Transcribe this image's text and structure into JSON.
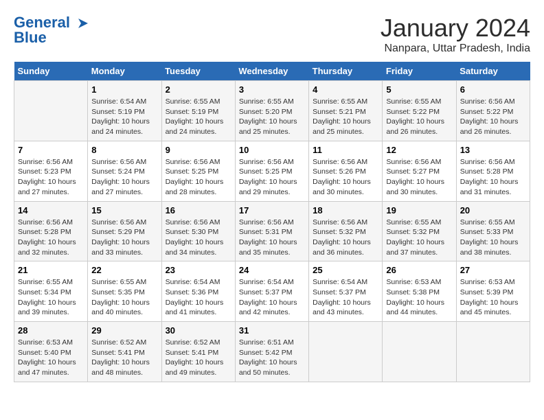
{
  "logo": {
    "line1": "General",
    "line2": "Blue"
  },
  "title": "January 2024",
  "subtitle": "Nanpara, Uttar Pradesh, India",
  "days_of_week": [
    "Sunday",
    "Monday",
    "Tuesday",
    "Wednesday",
    "Thursday",
    "Friday",
    "Saturday"
  ],
  "weeks": [
    [
      {
        "day": "",
        "sunrise": "",
        "sunset": "",
        "daylight": ""
      },
      {
        "day": "1",
        "sunrise": "Sunrise: 6:54 AM",
        "sunset": "Sunset: 5:19 PM",
        "daylight": "Daylight: 10 hours and 24 minutes."
      },
      {
        "day": "2",
        "sunrise": "Sunrise: 6:55 AM",
        "sunset": "Sunset: 5:19 PM",
        "daylight": "Daylight: 10 hours and 24 minutes."
      },
      {
        "day": "3",
        "sunrise": "Sunrise: 6:55 AM",
        "sunset": "Sunset: 5:20 PM",
        "daylight": "Daylight: 10 hours and 25 minutes."
      },
      {
        "day": "4",
        "sunrise": "Sunrise: 6:55 AM",
        "sunset": "Sunset: 5:21 PM",
        "daylight": "Daylight: 10 hours and 25 minutes."
      },
      {
        "day": "5",
        "sunrise": "Sunrise: 6:55 AM",
        "sunset": "Sunset: 5:22 PM",
        "daylight": "Daylight: 10 hours and 26 minutes."
      },
      {
        "day": "6",
        "sunrise": "Sunrise: 6:56 AM",
        "sunset": "Sunset: 5:22 PM",
        "daylight": "Daylight: 10 hours and 26 minutes."
      }
    ],
    [
      {
        "day": "7",
        "sunrise": "Sunrise: 6:56 AM",
        "sunset": "Sunset: 5:23 PM",
        "daylight": "Daylight: 10 hours and 27 minutes."
      },
      {
        "day": "8",
        "sunrise": "Sunrise: 6:56 AM",
        "sunset": "Sunset: 5:24 PM",
        "daylight": "Daylight: 10 hours and 27 minutes."
      },
      {
        "day": "9",
        "sunrise": "Sunrise: 6:56 AM",
        "sunset": "Sunset: 5:25 PM",
        "daylight": "Daylight: 10 hours and 28 minutes."
      },
      {
        "day": "10",
        "sunrise": "Sunrise: 6:56 AM",
        "sunset": "Sunset: 5:25 PM",
        "daylight": "Daylight: 10 hours and 29 minutes."
      },
      {
        "day": "11",
        "sunrise": "Sunrise: 6:56 AM",
        "sunset": "Sunset: 5:26 PM",
        "daylight": "Daylight: 10 hours and 30 minutes."
      },
      {
        "day": "12",
        "sunrise": "Sunrise: 6:56 AM",
        "sunset": "Sunset: 5:27 PM",
        "daylight": "Daylight: 10 hours and 30 minutes."
      },
      {
        "day": "13",
        "sunrise": "Sunrise: 6:56 AM",
        "sunset": "Sunset: 5:28 PM",
        "daylight": "Daylight: 10 hours and 31 minutes."
      }
    ],
    [
      {
        "day": "14",
        "sunrise": "Sunrise: 6:56 AM",
        "sunset": "Sunset: 5:28 PM",
        "daylight": "Daylight: 10 hours and 32 minutes."
      },
      {
        "day": "15",
        "sunrise": "Sunrise: 6:56 AM",
        "sunset": "Sunset: 5:29 PM",
        "daylight": "Daylight: 10 hours and 33 minutes."
      },
      {
        "day": "16",
        "sunrise": "Sunrise: 6:56 AM",
        "sunset": "Sunset: 5:30 PM",
        "daylight": "Daylight: 10 hours and 34 minutes."
      },
      {
        "day": "17",
        "sunrise": "Sunrise: 6:56 AM",
        "sunset": "Sunset: 5:31 PM",
        "daylight": "Daylight: 10 hours and 35 minutes."
      },
      {
        "day": "18",
        "sunrise": "Sunrise: 6:56 AM",
        "sunset": "Sunset: 5:32 PM",
        "daylight": "Daylight: 10 hours and 36 minutes."
      },
      {
        "day": "19",
        "sunrise": "Sunrise: 6:55 AM",
        "sunset": "Sunset: 5:32 PM",
        "daylight": "Daylight: 10 hours and 37 minutes."
      },
      {
        "day": "20",
        "sunrise": "Sunrise: 6:55 AM",
        "sunset": "Sunset: 5:33 PM",
        "daylight": "Daylight: 10 hours and 38 minutes."
      }
    ],
    [
      {
        "day": "21",
        "sunrise": "Sunrise: 6:55 AM",
        "sunset": "Sunset: 5:34 PM",
        "daylight": "Daylight: 10 hours and 39 minutes."
      },
      {
        "day": "22",
        "sunrise": "Sunrise: 6:55 AM",
        "sunset": "Sunset: 5:35 PM",
        "daylight": "Daylight: 10 hours and 40 minutes."
      },
      {
        "day": "23",
        "sunrise": "Sunrise: 6:54 AM",
        "sunset": "Sunset: 5:36 PM",
        "daylight": "Daylight: 10 hours and 41 minutes."
      },
      {
        "day": "24",
        "sunrise": "Sunrise: 6:54 AM",
        "sunset": "Sunset: 5:37 PM",
        "daylight": "Daylight: 10 hours and 42 minutes."
      },
      {
        "day": "25",
        "sunrise": "Sunrise: 6:54 AM",
        "sunset": "Sunset: 5:37 PM",
        "daylight": "Daylight: 10 hours and 43 minutes."
      },
      {
        "day": "26",
        "sunrise": "Sunrise: 6:53 AM",
        "sunset": "Sunset: 5:38 PM",
        "daylight": "Daylight: 10 hours and 44 minutes."
      },
      {
        "day": "27",
        "sunrise": "Sunrise: 6:53 AM",
        "sunset": "Sunset: 5:39 PM",
        "daylight": "Daylight: 10 hours and 45 minutes."
      }
    ],
    [
      {
        "day": "28",
        "sunrise": "Sunrise: 6:53 AM",
        "sunset": "Sunset: 5:40 PM",
        "daylight": "Daylight: 10 hours and 47 minutes."
      },
      {
        "day": "29",
        "sunrise": "Sunrise: 6:52 AM",
        "sunset": "Sunset: 5:41 PM",
        "daylight": "Daylight: 10 hours and 48 minutes."
      },
      {
        "day": "30",
        "sunrise": "Sunrise: 6:52 AM",
        "sunset": "Sunset: 5:41 PM",
        "daylight": "Daylight: 10 hours and 49 minutes."
      },
      {
        "day": "31",
        "sunrise": "Sunrise: 6:51 AM",
        "sunset": "Sunset: 5:42 PM",
        "daylight": "Daylight: 10 hours and 50 minutes."
      },
      {
        "day": "",
        "sunrise": "",
        "sunset": "",
        "daylight": ""
      },
      {
        "day": "",
        "sunrise": "",
        "sunset": "",
        "daylight": ""
      },
      {
        "day": "",
        "sunrise": "",
        "sunset": "",
        "daylight": ""
      }
    ]
  ]
}
